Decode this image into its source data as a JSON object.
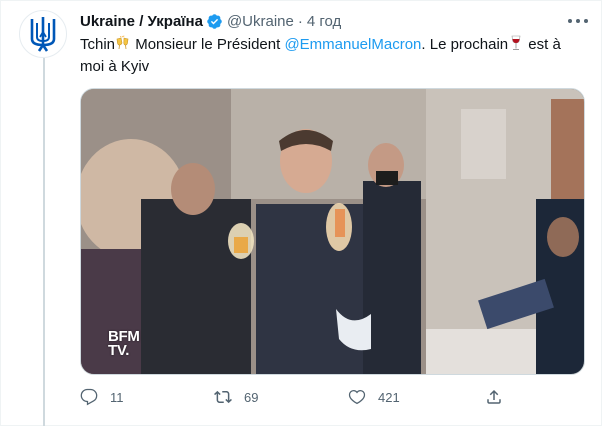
{
  "tweet": {
    "display_name": "Ukraine / Україна",
    "handle": "@Ukraine",
    "separator": "·",
    "time": "4 год",
    "text_part1": "Tchin",
    "text_part2": " Monsieur le Président ",
    "mention": "@EmmanuelMacron",
    "text_part3": ". Le prochain",
    "text_part4": " est à moi à Kyiv",
    "emoji_1": "clinking-glasses",
    "emoji_2": "wine-glass"
  },
  "media": {
    "watermark_line1": "BFM",
    "watermark_line2": "TV."
  },
  "actions": {
    "reply_count": "11",
    "retweet_count": "69",
    "like_count": "421"
  },
  "colors": {
    "accent": "#1d9bf0",
    "secondary_text": "#536471",
    "verified": "#1d9bf0",
    "trident": "#0057b7",
    "trident_gold": "#ffd700"
  }
}
